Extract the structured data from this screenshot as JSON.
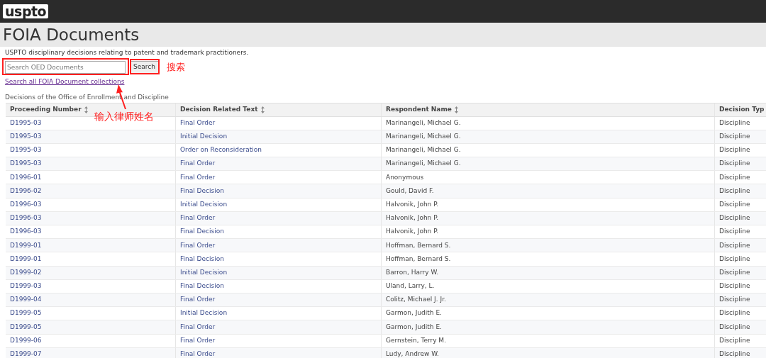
{
  "header": {
    "logo": "uspto"
  },
  "page_title": "FOIA Documents",
  "description": "USPTO disciplinary decisions relating to patent and trademark practitioners.",
  "search": {
    "placeholder": "Search OED Documents",
    "button": "Search"
  },
  "collections_link": "Search all FOIA Document collections",
  "table_caption": "Decisions of the Office of Enrollment and Discipline",
  "table": {
    "columns": [
      {
        "label": "Proceeding Number",
        "sortable": true
      },
      {
        "label": "Decision Related Text",
        "sortable": true
      },
      {
        "label": "Respondent Name",
        "sortable": true
      },
      {
        "label": "Decision Typ",
        "sortable": false
      }
    ],
    "rows": [
      [
        "D1995-03",
        "Final Order",
        "Marinangeli, Michael G.",
        "Discipline"
      ],
      [
        "D1995-03",
        "Initial Decision",
        "Marinangeli, Michael G.",
        "Discipline"
      ],
      [
        "D1995-03",
        "Order on Reconsideration",
        "Marinangeli, Michael G.",
        "Discipline"
      ],
      [
        "D1995-03",
        "Final Order",
        "Marinangeli, Michael G.",
        "Discipline"
      ],
      [
        "D1996-01",
        "Final Order",
        "Anonymous",
        "Discipline"
      ],
      [
        "D1996-02",
        "Final Decision",
        "Gould, David F.",
        "Discipline"
      ],
      [
        "D1996-03",
        "Initial Decision",
        "Halvonik, John P.",
        "Discipline"
      ],
      [
        "D1996-03",
        "Final Order",
        "Halvonik, John P.",
        "Discipline"
      ],
      [
        "D1996-03",
        "Final Decision",
        "Halvonik, John P.",
        "Discipline"
      ],
      [
        "D1999-01",
        "Final Order",
        "Hoffman, Bernard S.",
        "Discipline"
      ],
      [
        "D1999-01",
        "Final Decision",
        "Hoffman, Bernard S.",
        "Discipline"
      ],
      [
        "D1999-02",
        "Initial Decision",
        "Barron, Harry W.",
        "Discipline"
      ],
      [
        "D1999-03",
        "Final Decision",
        "Uland, Larry, L.",
        "Discipline"
      ],
      [
        "D1999-04",
        "Final Order",
        "Colitz, Michael J. Jr.",
        "Discipline"
      ],
      [
        "D1999-05",
        "Initial Decision",
        "Garmon, Judith E.",
        "Discipline"
      ],
      [
        "D1999-05",
        "Final Order",
        "Garmon, Judith E.",
        "Discipline"
      ],
      [
        "D1999-06",
        "Final Order",
        "Gernstein, Terry M.",
        "Discipline"
      ],
      [
        "D1999-07",
        "Final Order",
        "Ludy, Andrew W.",
        "Discipline"
      ]
    ]
  },
  "annotations": [
    {
      "kind": "label",
      "text": "搜索"
    },
    {
      "kind": "label",
      "text": "输入律师姓名"
    }
  ]
}
